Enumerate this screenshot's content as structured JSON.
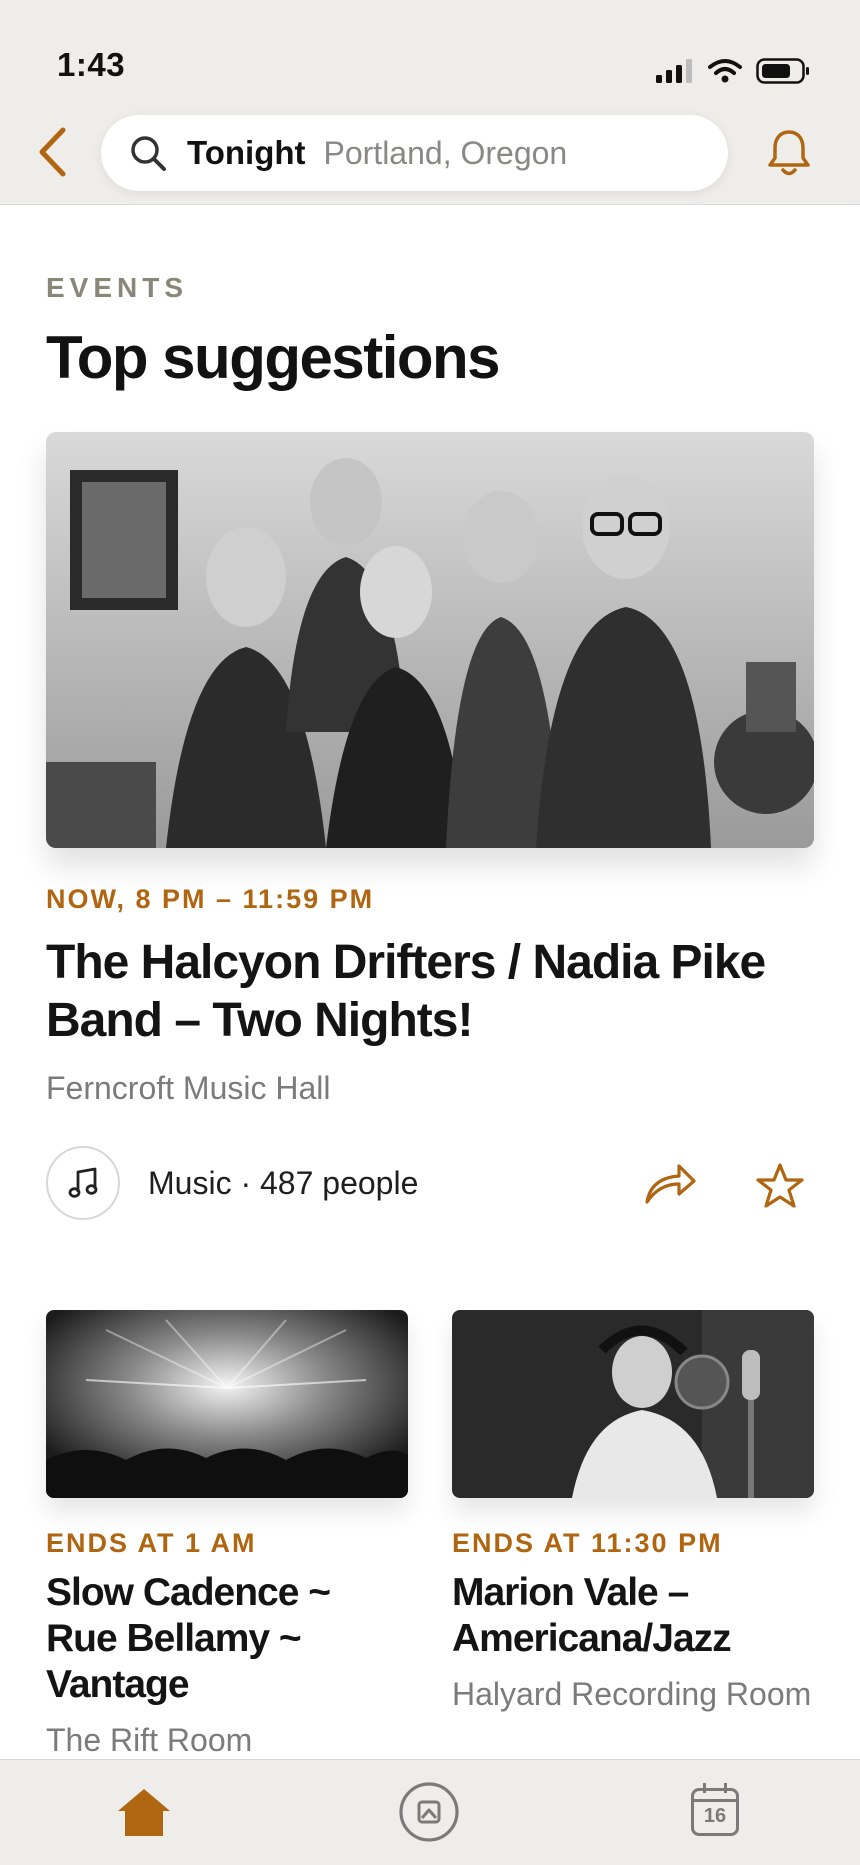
{
  "status_bar": {
    "time": "1:43"
  },
  "header": {
    "back_icon": "chevron-left-icon",
    "search": {
      "primary": "Tonight",
      "secondary": "Portland, Oregon"
    },
    "bell_icon": "bell-icon"
  },
  "section": {
    "kicker": "EVENTS",
    "title": "Top suggestions"
  },
  "featured": {
    "time": "NOW, 8 PM – 11:59 PM",
    "title": "The Halcyon Drifters / Nadia Pike Band – Two Nights!",
    "venue": "Ferncroft Music Hall",
    "category_icon": "music-note-icon",
    "meta": "Music · 487 people"
  },
  "cards": [
    {
      "time": "ENDS AT 1 AM",
      "title": "Slow Cadence ~ Rue Bellamy ~ Vantage",
      "venue": "The Rift Room"
    },
    {
      "time": "ENDS AT 11:30 PM",
      "title": "Marion Vale – Americana/Jazz",
      "venue": "Halyard Recording Room"
    }
  ],
  "tabbar": {
    "calendar_day": "16",
    "tabs": [
      "home-icon",
      "discover-icon",
      "calendar-icon"
    ]
  },
  "colors": {
    "accent": "#b06510",
    "kicker": "#8a8778",
    "bar_background": "#efedea"
  }
}
